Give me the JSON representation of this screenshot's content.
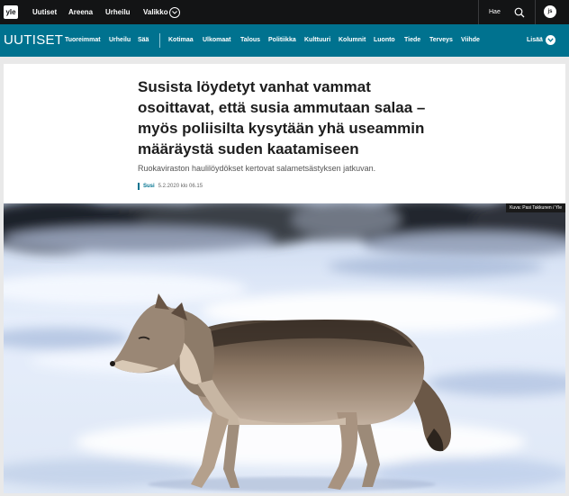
{
  "topbar": {
    "logo": "yle",
    "nav": [
      "Uutiset",
      "Areena",
      "Urheilu",
      "Valikko"
    ],
    "search_label": "Hae",
    "avatar": "js"
  },
  "subnav": {
    "brand": "UUTISET",
    "items": [
      "Tuoreimmat",
      "Urheilu",
      "Sää",
      "Kotimaa",
      "Ulkomaat",
      "Talous",
      "Politiikka",
      "Kulttuuri",
      "Kolumnit",
      "Luonto",
      "Tiede",
      "Terveys",
      "Viihde"
    ],
    "more": "Lisää"
  },
  "article": {
    "headline": "Susista löydetyt vanhat vammat osoittavat, että susia ammutaan salaa – myös poliisilta kysytään yhä useammin määräystä suden kaatamiseen",
    "lead": "Ruokaviraston haulilöydökset kertovat salametsästyksen jatkuvan.",
    "tag": "Susi",
    "date": "5.2.2020 klo 06.15",
    "photo_credit": "Kuva: Pasi Takkunen / Yle"
  },
  "colors": {
    "topbar": "#131415",
    "nav": "#00728f",
    "headline": "#1d1d1d"
  }
}
